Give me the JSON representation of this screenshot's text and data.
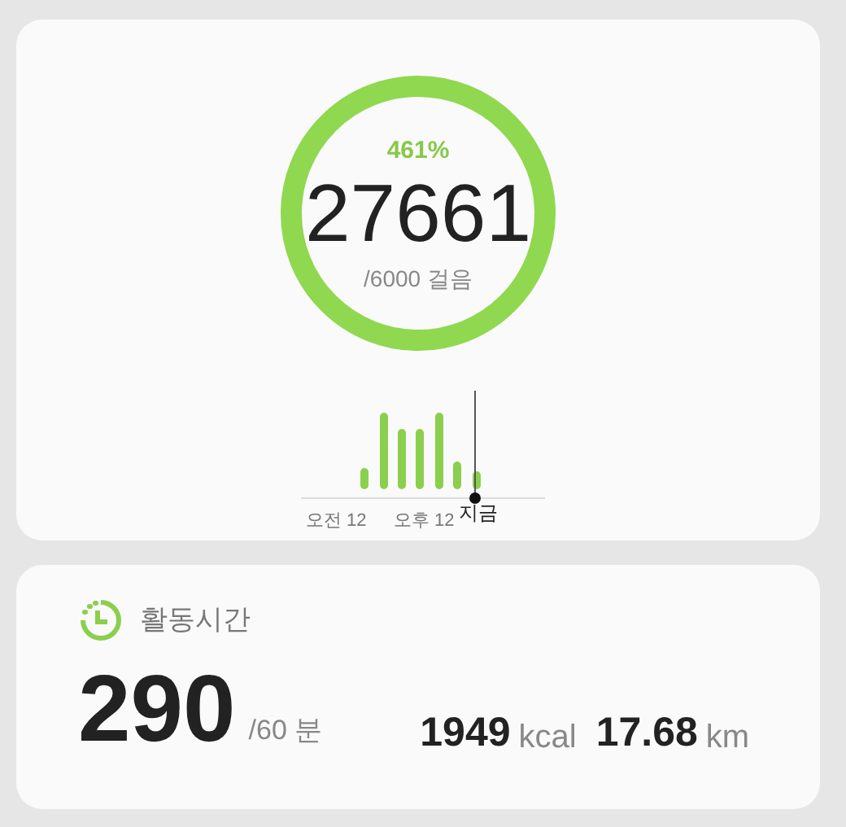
{
  "steps": {
    "percent": "461%",
    "count": "27661",
    "goal": "/6000 걸음"
  },
  "timeline": {
    "labels": [
      "오전 12",
      "오후 12"
    ],
    "now_label": "지금"
  },
  "activity": {
    "title": "활동시간",
    "minutes": "290",
    "goal": "/60 분",
    "calories": "1949",
    "calories_unit": "kcal",
    "distance": "17.68",
    "distance_unit": "km"
  }
}
